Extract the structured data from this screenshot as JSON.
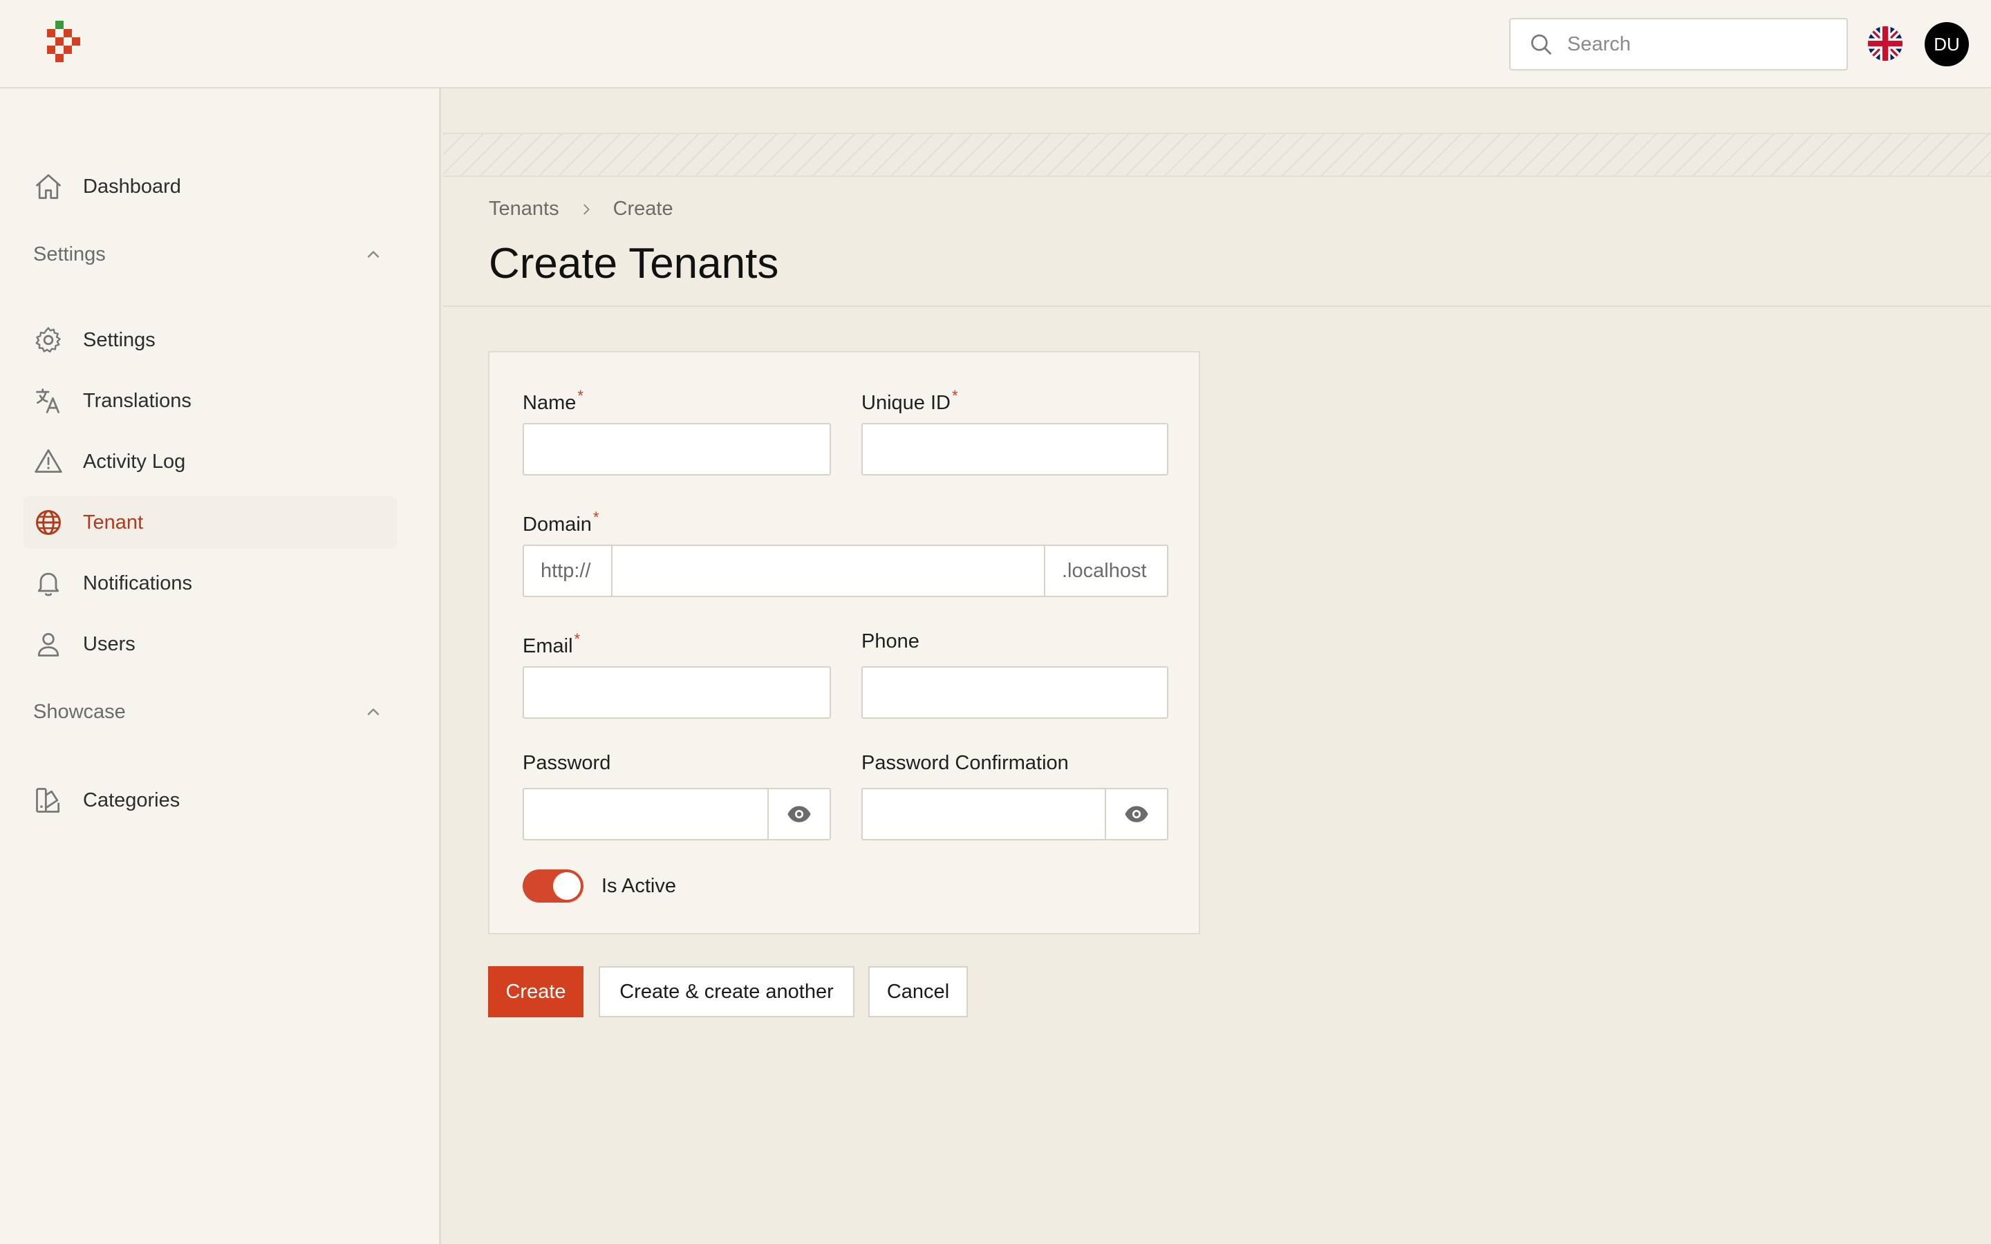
{
  "topbar": {
    "search_placeholder": "Search",
    "avatar_initials": "DU"
  },
  "sidebar": {
    "dashboard": "Dashboard",
    "groups": [
      {
        "label": "Settings",
        "items": [
          "Settings",
          "Translations",
          "Activity Log",
          "Tenant",
          "Notifications",
          "Users"
        ]
      },
      {
        "label": "Showcase",
        "items": [
          "Categories"
        ]
      }
    ],
    "active_item": "Tenant"
  },
  "breadcrumb": {
    "parent": "Tenants",
    "current": "Create"
  },
  "page_title": "Create Tenants",
  "form": {
    "name_label": "Name",
    "unique_id_label": "Unique ID",
    "domain_label": "Domain",
    "domain_prefix": "http://",
    "domain_suffix": ".localhost",
    "email_label": "Email",
    "phone_label": "Phone",
    "password_label": "Password",
    "password_confirmation_label": "Password Confirmation",
    "required_mark": "*",
    "is_active_label": "Is Active",
    "is_active": true
  },
  "actions": {
    "create": "Create",
    "create_another": "Create & create another",
    "cancel": "Cancel"
  },
  "colors": {
    "accent": "#d2401f",
    "active_nav_text": "#b23a1d",
    "background": "#f0ece2",
    "panel": "#f7f3ed"
  }
}
